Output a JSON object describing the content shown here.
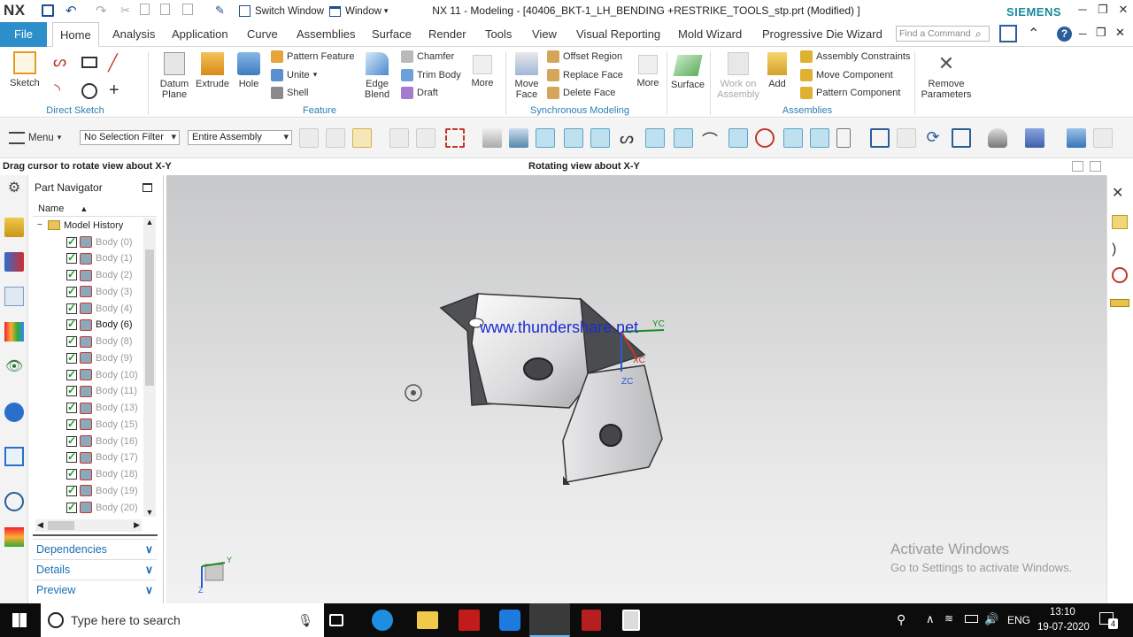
{
  "app": {
    "logo": "NX",
    "title": "NX 11 - Modeling - [40406_BKT-1_LH_BENDING +RESTRIKE_TOOLS_stp.prt (Modified) ]",
    "brand": "SIEMENS",
    "quick": {
      "switch_window": "Switch Window",
      "window": "Window"
    }
  },
  "tabs": {
    "file": "File",
    "items": [
      "Home",
      "Analysis",
      "Application",
      "Curve",
      "Assemblies",
      "Surface",
      "Render",
      "Tools",
      "View",
      "Visual Reporting",
      "Mold Wizard",
      "Progressive Die Wizard"
    ],
    "find_placeholder": "Find a Command"
  },
  "ribbon": {
    "sketch": "Sketch",
    "direct_sketch": "Direct Sketch",
    "datum_plane": "Datum Plane",
    "extrude": "Extrude",
    "hole": "Hole",
    "pattern_feature": "Pattern Feature",
    "unite": "Unite",
    "shell": "Shell",
    "edge_blend": "Edge Blend",
    "chamfer": "Chamfer",
    "trim_body": "Trim Body",
    "draft": "Draft",
    "more": "More",
    "feature": "Feature",
    "move_face": "Move Face",
    "offset_region": "Offset Region",
    "replace_face": "Replace Face",
    "delete_face": "Delete Face",
    "synchronous_modeling": "Synchronous Modeling",
    "surface": "Surface",
    "work_on_assembly": "Work on Assembly",
    "add": "Add",
    "assembly_constraints": "Assembly Constraints",
    "move_component": "Move Component",
    "pattern_component": "Pattern Component",
    "assemblies": "Assemblies",
    "remove_parameters": "Remove Parameters"
  },
  "toolbar2": {
    "menu": "Menu",
    "selection_filter": "No Selection Filter",
    "scope": "Entire Assembly"
  },
  "status": {
    "left": "Drag cursor to rotate view about X-Y",
    "center": "Rotating view about X-Y"
  },
  "navigator": {
    "title": "Part Navigator",
    "col_name": "Name",
    "root": "Model History",
    "bodies": [
      "Body (0)",
      "Body (1)",
      "Body (2)",
      "Body (3)",
      "Body (4)",
      "Body (6)",
      "Body (8)",
      "Body (9)",
      "Body (10)",
      "Body (11)",
      "Body (13)",
      "Body (15)",
      "Body (16)",
      "Body (17)",
      "Body (18)",
      "Body (19)",
      "Body (20)"
    ],
    "active_body_index": 5,
    "panels": [
      "Dependencies",
      "Details",
      "Preview"
    ]
  },
  "viewport": {
    "watermark": "www.thundershare.net",
    "axis_yc": "YC",
    "axis_xc": "XC",
    "axis_zc": "ZC",
    "triad_y": "Y",
    "triad_z": "Z",
    "activate_title": "Activate Windows",
    "activate_sub": "Go to Settings to activate Windows."
  },
  "taskbar": {
    "search": "Type here to search",
    "lang": "ENG",
    "time": "13:10",
    "date": "19-07-2020",
    "notification_count": "4"
  }
}
